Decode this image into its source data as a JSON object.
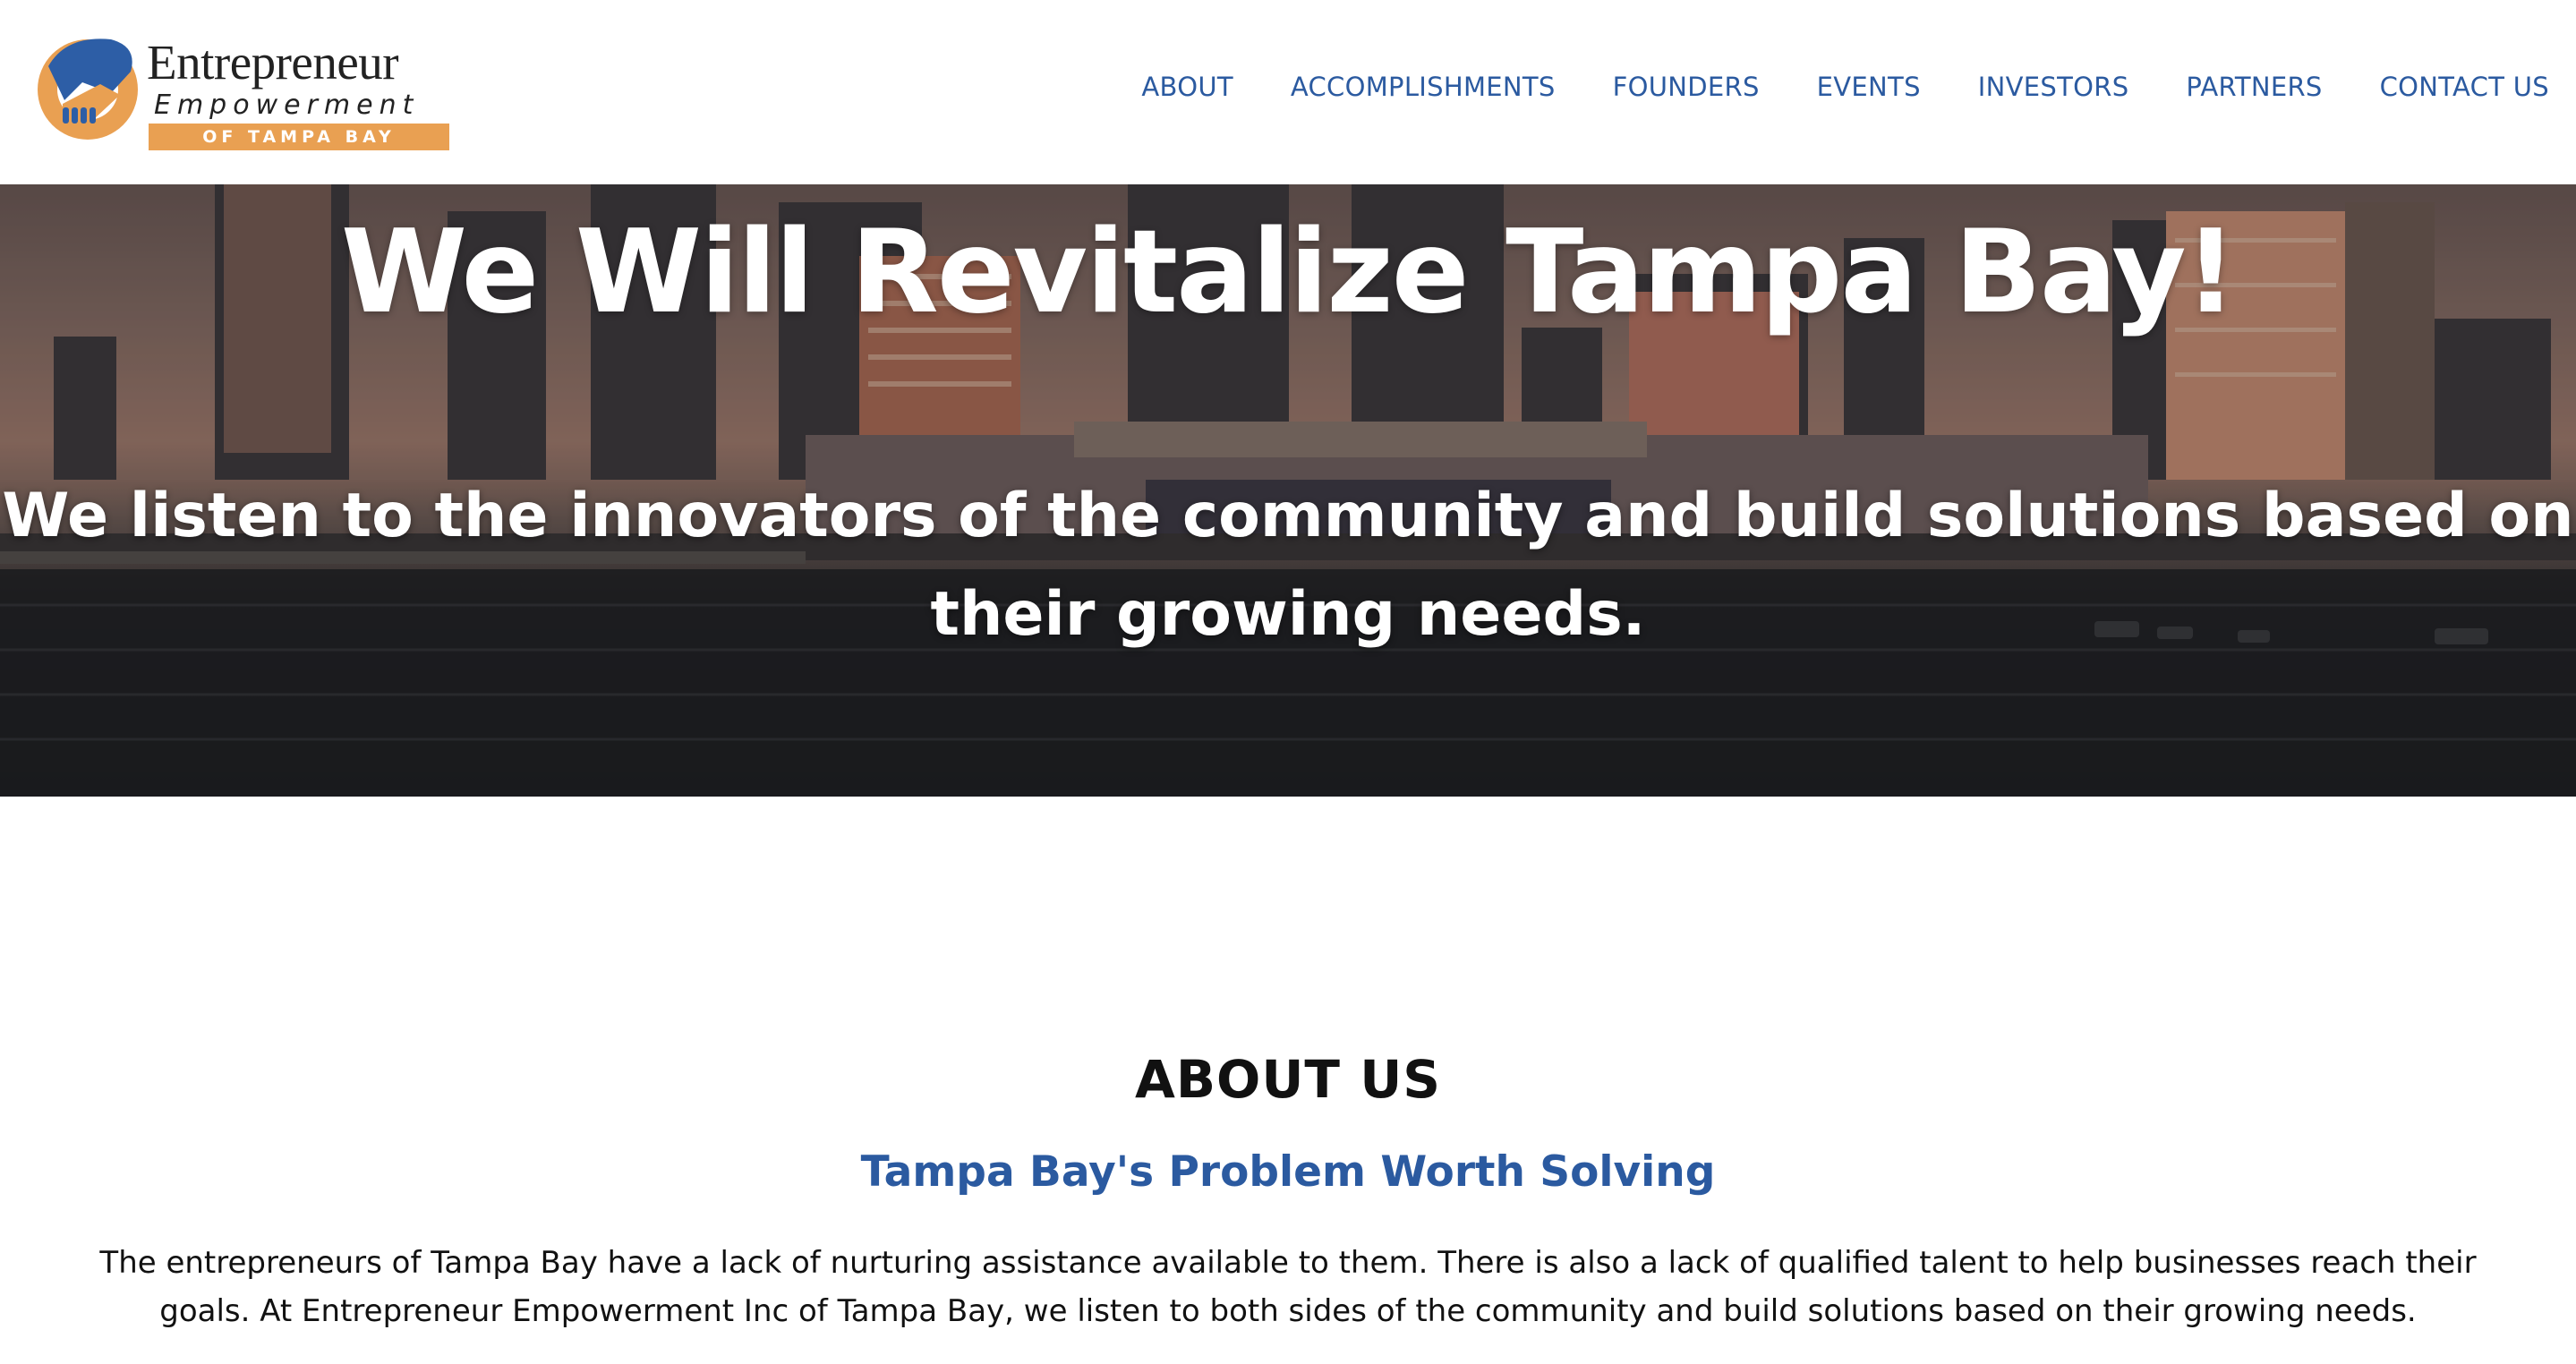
{
  "logo": {
    "word1": "Entrepreneur",
    "word2": "Empowerment",
    "band": "OF TAMPA BAY"
  },
  "nav": {
    "items": [
      {
        "label": "ABOUT"
      },
      {
        "label": "ACCOMPLISHMENTS"
      },
      {
        "label": "FOUNDERS"
      },
      {
        "label": "EVENTS"
      },
      {
        "label": "INVESTORS"
      },
      {
        "label": "PARTNERS"
      },
      {
        "label": "CONTACT US"
      }
    ]
  },
  "hero": {
    "title": "We Will Revitalize Tampa Bay!",
    "subtitle": "We listen to the innovators of the community and build solutions based on their growing needs."
  },
  "about": {
    "heading": "ABOUT US",
    "subheading": "Tampa Bay's Problem Worth Solving",
    "body": "The entrepreneurs of Tampa Bay have a lack of nurturing assistance available to them. There is also a lack of qualified talent to help businesses reach their goals. At Entrepreneur Empowerment Inc of Tampa Bay, we listen to both sides of the community and build solutions based on their growing needs."
  },
  "colors": {
    "nav_text": "#2b5aa0",
    "logo_orange": "#e9a052",
    "logo_blue": "#2d5ea6",
    "subheading": "#2b5aa0"
  },
  "icons": {
    "logo_mark": "handshake-logo-icon"
  }
}
